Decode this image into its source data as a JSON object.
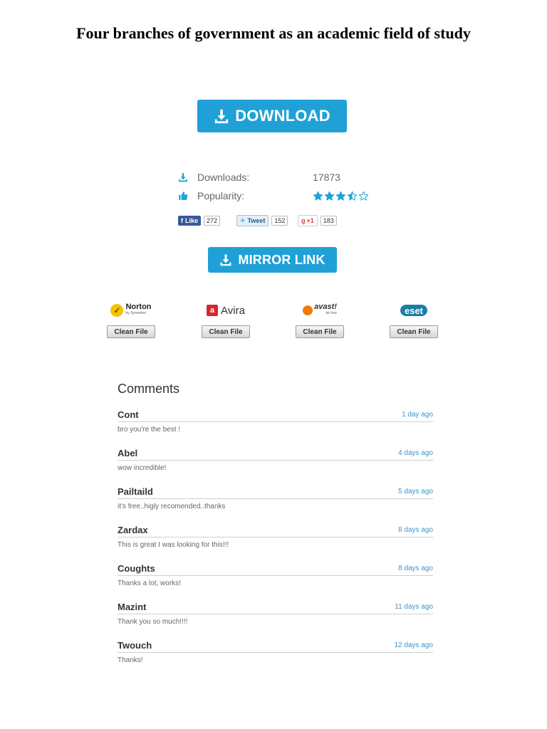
{
  "page": {
    "title": "Four branches of government as an academic field of study"
  },
  "download": {
    "label": "DOWNLOAD"
  },
  "stats": {
    "downloads_label": "Downloads:",
    "downloads_value": "17873",
    "popularity_label": "Popularity:",
    "popularity_rating": 3.5,
    "popularity_max": 5
  },
  "social": {
    "facebook": {
      "label": "Like",
      "count": "272"
    },
    "twitter": {
      "label": "Tweet",
      "count": "152"
    },
    "google": {
      "label": "+1",
      "count": "183"
    }
  },
  "mirror": {
    "label": "MIRROR LINK"
  },
  "antivirus": {
    "clean_label": "Clean File",
    "items": [
      {
        "name": "Norton",
        "subtitle": "by Symantec",
        "color": "#f6c200"
      },
      {
        "name": "Avira",
        "color": "#d8262e"
      },
      {
        "name": "avast!",
        "subtitle": "be free",
        "color": "#f07c00"
      },
      {
        "name": "eset",
        "color": "#1a7fa0"
      }
    ]
  },
  "comments": {
    "title": "Comments",
    "items": [
      {
        "name": "Cont",
        "time": "1 day ago",
        "text": "bro you're the best !"
      },
      {
        "name": "Abel",
        "time": "4 days ago",
        "text": "wow incredible!"
      },
      {
        "name": "Pailtaild",
        "time": "5 days ago",
        "text": "it's free..higly recomended..thanks"
      },
      {
        "name": "Zardax",
        "time": "8 days ago",
        "text": "This is great I was looking for this!!!"
      },
      {
        "name": "Coughts",
        "time": "8 days ago",
        "text": "Thanks a lot, works!"
      },
      {
        "name": "Mazint",
        "time": "11 days ago",
        "text": "Thank you so much!!!!"
      },
      {
        "name": "Twouch",
        "time": "12 days ago",
        "text": "Thanks!"
      }
    ]
  },
  "colors": {
    "accent": "#1fa1d8",
    "link": "#3b94c7"
  }
}
